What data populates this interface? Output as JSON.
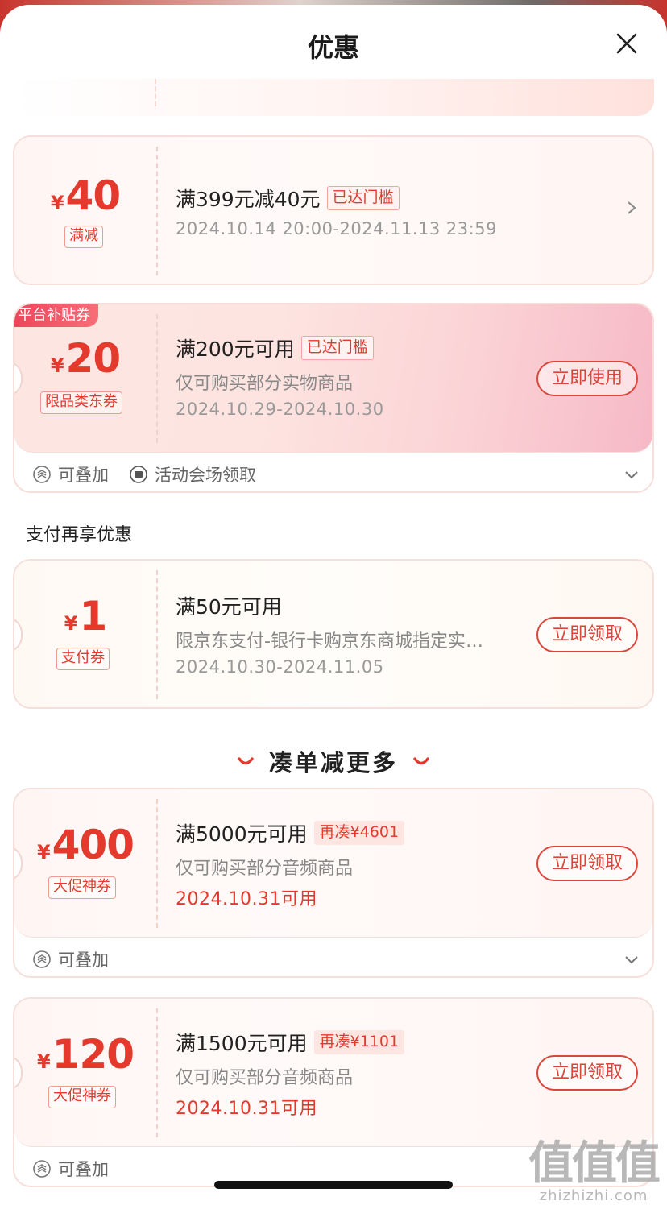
{
  "header": {
    "title": "优惠"
  },
  "coupons": [
    {
      "currency": "¥",
      "amount": "40",
      "type_tag": "满减",
      "title": "满399元减40元",
      "badge": "已达门槛",
      "validity": "2024.10.14 20:00-2024.11.13 23:59"
    },
    {
      "corner_badge": "平台补贴券",
      "currency": "¥",
      "amount": "20",
      "type_tag": "限品类东券",
      "title": "满200元可用",
      "badge": "已达门槛",
      "desc": "仅可购买部分实物商品",
      "validity": "2024.10.29-2024.10.30",
      "button": "立即使用",
      "footer": {
        "stackable": "可叠加",
        "source": "活动会场领取"
      }
    }
  ],
  "pay_section": {
    "title": "支付再享优惠",
    "coupon": {
      "currency": "¥",
      "amount": "1",
      "type_tag": "支付券",
      "title": "满50元可用",
      "desc": "限京东支付-银行卡购京东商城指定实…",
      "validity": "2024.10.30-2024.11.05",
      "button": "立即领取"
    }
  },
  "more_section": {
    "title": "凑单减更多",
    "coupons": [
      {
        "currency": "¥",
        "amount": "400",
        "type_tag": "大促神券",
        "title": "满5000元可用",
        "badge": "再凑¥4601",
        "desc": "仅可购买部分音频商品",
        "validity": "2024.10.31可用",
        "button": "立即领取",
        "footer": {
          "stackable": "可叠加"
        }
      },
      {
        "currency": "¥",
        "amount": "120",
        "type_tag": "大促神券",
        "title": "满1500元可用",
        "badge": "再凑¥1101",
        "desc": "仅可购买部分音频商品",
        "validity": "2024.10.31可用",
        "button": "立即领取",
        "footer": {
          "stackable": "可叠加"
        }
      }
    ]
  },
  "watermark": {
    "big": "值值值",
    "small": "zhizhizhi.com"
  },
  "colors": {
    "accent": "#e4392c",
    "button": "#d9463a",
    "text": "#222222",
    "muted": "#888888"
  },
  "icons": [
    "close-icon",
    "chevron-right-icon",
    "chevron-down-icon",
    "stack-icon",
    "venue-icon",
    "smile-icon"
  ]
}
